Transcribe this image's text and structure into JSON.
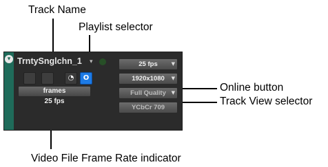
{
  "callouts": {
    "track_name": "Track Name",
    "playlist_selector": "Playlist selector",
    "online_button": "Online button",
    "track_view_selector": "Track View selector",
    "video_frame_rate": "Video File Frame Rate indicator"
  },
  "track": {
    "name": "TrntySnglchn_1",
    "expand_icon": "expand-arrow-icon",
    "playlist_icon": "chevron-down-icon",
    "status_color": "#274f27",
    "buttons": {
      "video_online_symbol": "O",
      "video_online_color": "#1d7be6",
      "clock_symbol": "◔"
    },
    "track_view_value": "frames",
    "video_frame_rate": "25 fps",
    "dropdowns": {
      "frame_rate": "25 fps",
      "resolution": "1920x1080",
      "quality": "Full Quality",
      "color_space": "YCbCr 709"
    }
  }
}
